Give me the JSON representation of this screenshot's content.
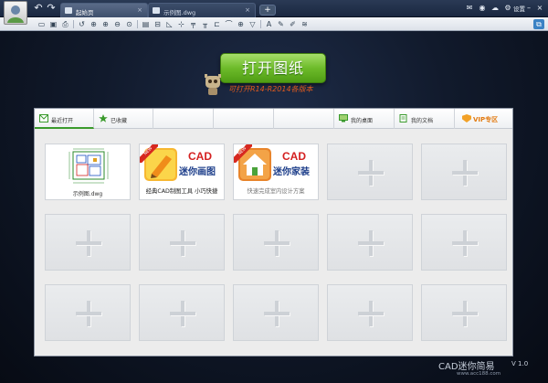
{
  "titlebar": {
    "tabs": [
      {
        "label": "起始页"
      },
      {
        "label": "示例图.dwg"
      }
    ],
    "add_tab": "+",
    "settings_label": "设置"
  },
  "main": {
    "open_button": "打开图纸",
    "support_text": "可打开R14-R2014各版本"
  },
  "panel": {
    "tabs": [
      {
        "label": "最近打开",
        "icon": "mail-icon"
      },
      {
        "label": "已收藏",
        "icon": "star-icon"
      },
      {
        "label": "",
        "icon": ""
      },
      {
        "label": "",
        "icon": ""
      },
      {
        "label": "",
        "icon": ""
      },
      {
        "label": "我的桌面",
        "icon": "desktop-icon"
      },
      {
        "label": "我的文档",
        "icon": "document-icon"
      }
    ],
    "vip_label": "VIP专区",
    "cards": [
      {
        "type": "file",
        "name": "示例图.dwg"
      },
      {
        "type": "promo",
        "badge": "NEW",
        "brand": "CAD",
        "title": "迷你画图",
        "subtitle": "经典CAD制图工具 小巧快捷"
      },
      {
        "type": "promo",
        "badge": "NEW",
        "brand": "CAD",
        "title": "迷你家装",
        "subtitle": "快速完成室内设计方案"
      }
    ]
  },
  "footer": {
    "product": "CAD迷你简易",
    "version": "V 1.0",
    "url": "www.acc188.com"
  },
  "colors": {
    "accent_green": "#6dbb2a",
    "vip_orange": "#e27a10",
    "promo_red": "#d42020",
    "promo_blue": "#1d3e8a"
  }
}
